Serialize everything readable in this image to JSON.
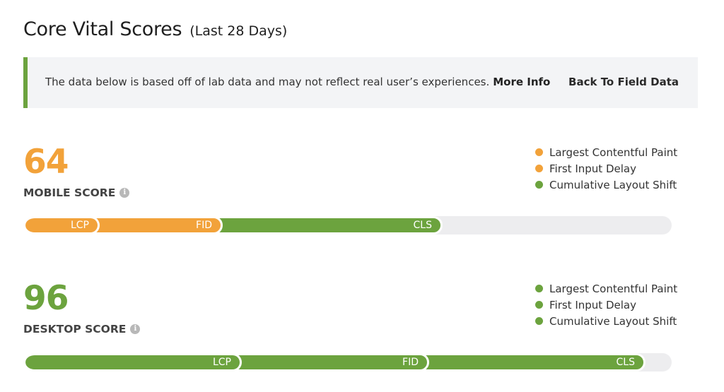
{
  "header": {
    "title": "Core Vital Scores",
    "subtitle": "(Last 28 Days)"
  },
  "notice": {
    "text": "The data below is based off of lab data and may not reflect real user’s experiences.",
    "more_info": "More Info",
    "back_link": "Back To Field Data",
    "accent_color": "#6ca33e"
  },
  "colors": {
    "orange": "#f2a23a",
    "green": "#6ca33e",
    "track": "#ededef"
  },
  "mobile": {
    "score": "64",
    "label": "MOBILE SCORE",
    "score_color": "#f2a23a",
    "legend": [
      {
        "label": "Largest Contentful Paint",
        "color": "#f2a23a"
      },
      {
        "label": "First Input Delay",
        "color": "#f2a23a"
      },
      {
        "label": "Cumulative Layout Shift",
        "color": "#6ca33e"
      }
    ],
    "segments": [
      {
        "label": "LCP",
        "fraction": 0.115,
        "color": "#f2a23a"
      },
      {
        "label": "FID",
        "fraction": 0.19,
        "color": "#f2a23a"
      },
      {
        "label": "CLS",
        "fraction": 0.34,
        "color": "#6ca33e"
      }
    ]
  },
  "desktop": {
    "score": "96",
    "label": "DESKTOP SCORE",
    "score_color": "#6ca33e",
    "legend": [
      {
        "label": "Largest Contentful Paint",
        "color": "#6ca33e"
      },
      {
        "label": "First Input Delay",
        "color": "#6ca33e"
      },
      {
        "label": "Cumulative Layout Shift",
        "color": "#6ca33e"
      }
    ],
    "segments": [
      {
        "label": "LCP",
        "fraction": 0.335,
        "color": "#6ca33e"
      },
      {
        "label": "FID",
        "fraction": 0.29,
        "color": "#6ca33e"
      },
      {
        "label": "CLS",
        "fraction": 0.335,
        "color": "#6ca33e"
      }
    ]
  }
}
